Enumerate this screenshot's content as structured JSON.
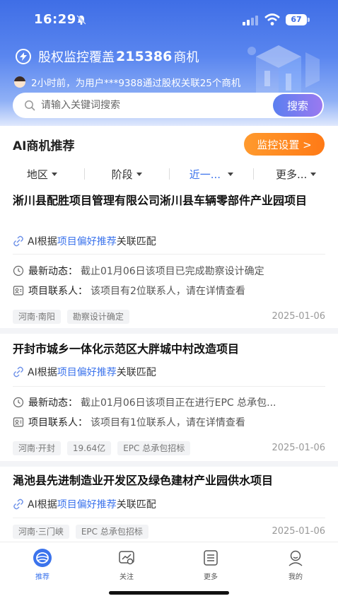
{
  "status_bar": {
    "time": "16:29",
    "battery": "67"
  },
  "banner": {
    "prefix": "股权监控覆盖",
    "count": "215386",
    "suffix": "商机",
    "notice": "2小时前，为用户***9388通过股权关联25个商机"
  },
  "search": {
    "placeholder": "请输入关键词搜索",
    "button": "搜索"
  },
  "section": {
    "title": "AI商机推荐",
    "monitor_button": "监控设置 >"
  },
  "filters": [
    {
      "label": "地区"
    },
    {
      "label": "阶段"
    },
    {
      "label": "近一..."
    },
    {
      "label": "更多..."
    }
  ],
  "cards": [
    {
      "title": "淅川县配胜项目管理有限公司淅川县车辆零部件产业园项目",
      "match_prefix": "AI根据",
      "match_highlight": "项目偏好推荐",
      "match_suffix": "关联匹配",
      "dynamic_label": "最新动态：",
      "dynamic_value": "截止01月06日该项目已完成勘察设计确定",
      "contact_label": "项目联系人：",
      "contact_value": "该项目有2位联系人，请在详情查看",
      "tags": [
        "河南·南阳",
        "勘察设计确定"
      ],
      "date": "2025-01-06"
    },
    {
      "title": "开封市城乡一体化示范区大胖城中村改造项目",
      "match_prefix": "AI根据",
      "match_highlight": "项目偏好推荐",
      "match_suffix": "关联匹配",
      "dynamic_label": "最新动态：",
      "dynamic_value": "截止01月06日该项目正在进行EPC 总承包...",
      "contact_label": "项目联系人：",
      "contact_value": "该项目有1位联系人，请在详情查看",
      "tags": [
        "河南·开封",
        "19.64亿",
        "EPC 总承包招标"
      ],
      "date": "2025-01-06"
    },
    {
      "title": "渑池县先进制造业开发区及绿色建材产业园供水项目",
      "match_prefix": "AI根据",
      "match_highlight": "项目偏好推荐",
      "match_suffix": "关联匹配",
      "tags": [
        "河南·三门峡",
        "EPC 总承包招标"
      ],
      "date": "2025-01-06"
    }
  ],
  "tabbar": [
    {
      "label": "推荐",
      "icon": "recommend-icon"
    },
    {
      "label": "关注",
      "icon": "follow-icon"
    },
    {
      "label": "更多",
      "icon": "more-icon"
    },
    {
      "label": "我的",
      "icon": "profile-icon"
    }
  ],
  "colors": {
    "primary": "#3b73ec",
    "accent": "#ff8a1f",
    "header": "#4a77ea"
  }
}
